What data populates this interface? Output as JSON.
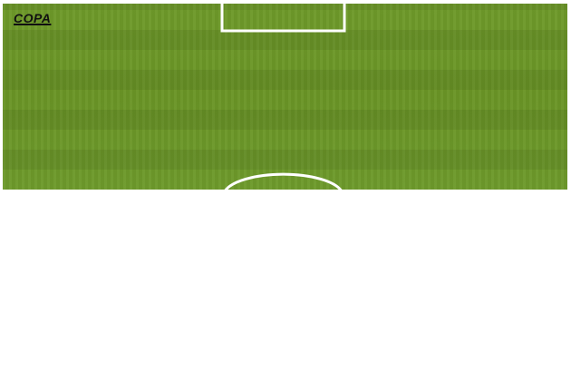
{
  "game": {
    "logo_text": "COPA"
  },
  "colors": {
    "grass": "#6d9a2b",
    "lines": "#ffffff",
    "background": "#ffffff",
    "logo": "#111111"
  }
}
